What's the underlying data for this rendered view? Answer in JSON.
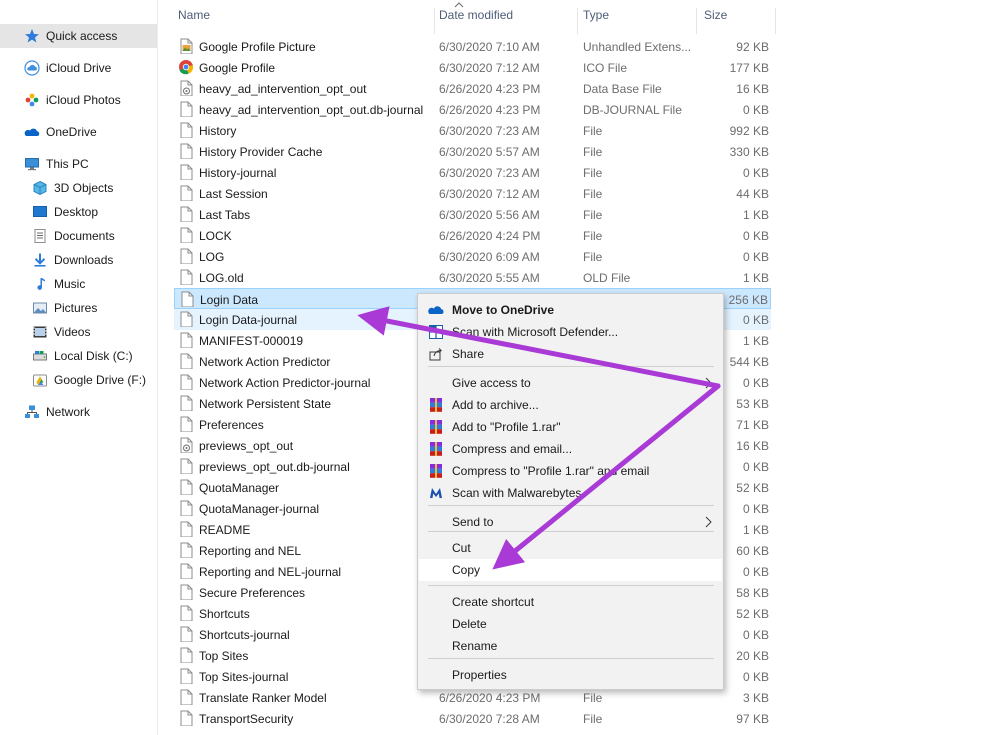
{
  "nav": [
    {
      "label": "Quick access",
      "icon": "star-icon",
      "selected": true
    },
    {
      "label": "iCloud Drive",
      "icon": "icloud-icon"
    },
    {
      "label": "iCloud Photos",
      "icon": "icloud-photos-icon"
    },
    {
      "label": "OneDrive",
      "icon": "onedrive-icon"
    },
    {
      "label": "This PC",
      "icon": "computer-icon"
    },
    {
      "label": "3D Objects",
      "icon": "cube-icon"
    },
    {
      "label": "Desktop",
      "icon": "desktop-icon"
    },
    {
      "label": "Documents",
      "icon": "documents-icon"
    },
    {
      "label": "Downloads",
      "icon": "download-icon"
    },
    {
      "label": "Music",
      "icon": "music-icon"
    },
    {
      "label": "Pictures",
      "icon": "pictures-icon"
    },
    {
      "label": "Videos",
      "icon": "videos-icon"
    },
    {
      "label": "Local Disk (C:)",
      "icon": "drive-icon"
    },
    {
      "label": "Google Drive (F:)",
      "icon": "google-drive-icon"
    },
    {
      "label": "Network",
      "icon": "network-icon"
    }
  ],
  "columns": {
    "name": "Name",
    "date": "Date modified",
    "type": "Type",
    "size": "Size"
  },
  "files": [
    {
      "name": "Google Profile Picture",
      "date": "6/30/2020 7:10 AM",
      "type": "Unhandled Extens...",
      "size": "92 KB",
      "icon": "image-file-icon"
    },
    {
      "name": "Google Profile",
      "date": "6/30/2020 7:12 AM",
      "type": "ICO File",
      "size": "177 KB",
      "icon": "chrome-icon"
    },
    {
      "name": "heavy_ad_intervention_opt_out",
      "date": "6/26/2020 4:23 PM",
      "type": "Data Base File",
      "size": "16 KB",
      "icon": "database-file-icon"
    },
    {
      "name": "heavy_ad_intervention_opt_out.db-journal",
      "date": "6/26/2020 4:23 PM",
      "type": "DB-JOURNAL File",
      "size": "0 KB",
      "icon": "file-icon"
    },
    {
      "name": "History",
      "date": "6/30/2020 7:23 AM",
      "type": "File",
      "size": "992 KB",
      "icon": "file-icon"
    },
    {
      "name": "History Provider Cache",
      "date": "6/30/2020 5:57 AM",
      "type": "File",
      "size": "330 KB",
      "icon": "file-icon"
    },
    {
      "name": "History-journal",
      "date": "6/30/2020 7:23 AM",
      "type": "File",
      "size": "0 KB",
      "icon": "file-icon"
    },
    {
      "name": "Last Session",
      "date": "6/30/2020 7:12 AM",
      "type": "File",
      "size": "44 KB",
      "icon": "file-icon"
    },
    {
      "name": "Last Tabs",
      "date": "6/30/2020 5:56 AM",
      "type": "File",
      "size": "1 KB",
      "icon": "file-icon"
    },
    {
      "name": "LOCK",
      "date": "6/26/2020 4:24 PM",
      "type": "File",
      "size": "0 KB",
      "icon": "file-icon"
    },
    {
      "name": "LOG",
      "date": "6/30/2020 6:09 AM",
      "type": "File",
      "size": "0 KB",
      "icon": "file-icon"
    },
    {
      "name": "LOG.old",
      "date": "6/30/2020 5:55 AM",
      "type": "OLD File",
      "size": "1 KB",
      "icon": "file-icon"
    },
    {
      "name": "Login Data",
      "date": "",
      "type": "",
      "size": "256 KB",
      "icon": "file-icon",
      "state": "selected"
    },
    {
      "name": "Login Data-journal",
      "date": "",
      "type": "",
      "size": "0 KB",
      "icon": "file-icon",
      "state": "hover"
    },
    {
      "name": "MANIFEST-000019",
      "date": "",
      "type": "",
      "size": "1 KB",
      "icon": "file-icon"
    },
    {
      "name": "Network Action Predictor",
      "date": "",
      "type": "",
      "size": "544 KB",
      "icon": "file-icon"
    },
    {
      "name": "Network Action Predictor-journal",
      "date": "",
      "type": "",
      "size": "0 KB",
      "icon": "file-icon"
    },
    {
      "name": "Network Persistent State",
      "date": "",
      "type": "",
      "size": "53 KB",
      "icon": "file-icon"
    },
    {
      "name": "Preferences",
      "date": "",
      "type": "",
      "size": "71 KB",
      "icon": "file-icon"
    },
    {
      "name": "previews_opt_out",
      "date": "",
      "type": "",
      "size": "16 KB",
      "icon": "database-file-icon"
    },
    {
      "name": "previews_opt_out.db-journal",
      "date": "",
      "type": "",
      "size": "0 KB",
      "icon": "file-icon"
    },
    {
      "name": "QuotaManager",
      "date": "",
      "type": "",
      "size": "52 KB",
      "icon": "file-icon"
    },
    {
      "name": "QuotaManager-journal",
      "date": "",
      "type": "",
      "size": "0 KB",
      "icon": "file-icon"
    },
    {
      "name": "README",
      "date": "",
      "type": "",
      "size": "1 KB",
      "icon": "file-icon"
    },
    {
      "name": "Reporting and NEL",
      "date": "",
      "type": "",
      "size": "60 KB",
      "icon": "file-icon"
    },
    {
      "name": "Reporting and NEL-journal",
      "date": "",
      "type": "",
      "size": "0 KB",
      "icon": "file-icon"
    },
    {
      "name": "Secure Preferences",
      "date": "",
      "type": "",
      "size": "58 KB",
      "icon": "file-icon"
    },
    {
      "name": "Shortcuts",
      "date": "",
      "type": "",
      "size": "52 KB",
      "icon": "file-icon"
    },
    {
      "name": "Shortcuts-journal",
      "date": "",
      "type": "",
      "size": "0 KB",
      "icon": "file-icon"
    },
    {
      "name": "Top Sites",
      "date": "",
      "type": "",
      "size": "20 KB",
      "icon": "file-icon"
    },
    {
      "name": "Top Sites-journal",
      "date": "",
      "type": "",
      "size": "0 KB",
      "icon": "file-icon"
    },
    {
      "name": "Translate Ranker Model",
      "date": "6/26/2020 4:23 PM",
      "type": "File",
      "size": "3 KB",
      "icon": "file-icon"
    },
    {
      "name": "TransportSecurity",
      "date": "6/30/2020 7:28 AM",
      "type": "File",
      "size": "97 KB",
      "icon": "file-icon"
    }
  ],
  "context_menu": {
    "groups": [
      [
        {
          "label": "Move to OneDrive",
          "icon": "onedrive-icon",
          "bold": true
        },
        {
          "label": "Scan with Microsoft Defender...",
          "icon": "defender-icon"
        },
        {
          "label": "Share",
          "icon": "share-icon"
        }
      ],
      [
        {
          "label": "Give access to",
          "submenu": true
        },
        {
          "label": "Add to archive...",
          "icon": "winrar-icon"
        },
        {
          "label": "Add to \"Profile 1.rar\"",
          "icon": "winrar-icon"
        },
        {
          "label": "Compress and email...",
          "icon": "winrar-icon"
        },
        {
          "label": "Compress to \"Profile 1.rar\" and email",
          "icon": "winrar-icon"
        },
        {
          "label": "Scan with Malwarebytes",
          "icon": "malwarebytes-icon"
        }
      ],
      [
        {
          "label": "Send to",
          "submenu": true
        }
      ],
      [
        {
          "label": "Cut"
        },
        {
          "label": "Copy",
          "hover": true
        }
      ],
      [
        {
          "label": "Create shortcut"
        },
        {
          "label": "Delete"
        },
        {
          "label": "Rename"
        }
      ],
      [
        {
          "label": "Properties"
        }
      ]
    ]
  },
  "colors": {
    "selection": "#cce8ff",
    "selection_border": "#99d1ff",
    "hover": "#e5f3ff",
    "annotation_arrow": "#a93ad6",
    "nav_selected": "#e5e5e5",
    "header_text": "#4d5d78"
  }
}
